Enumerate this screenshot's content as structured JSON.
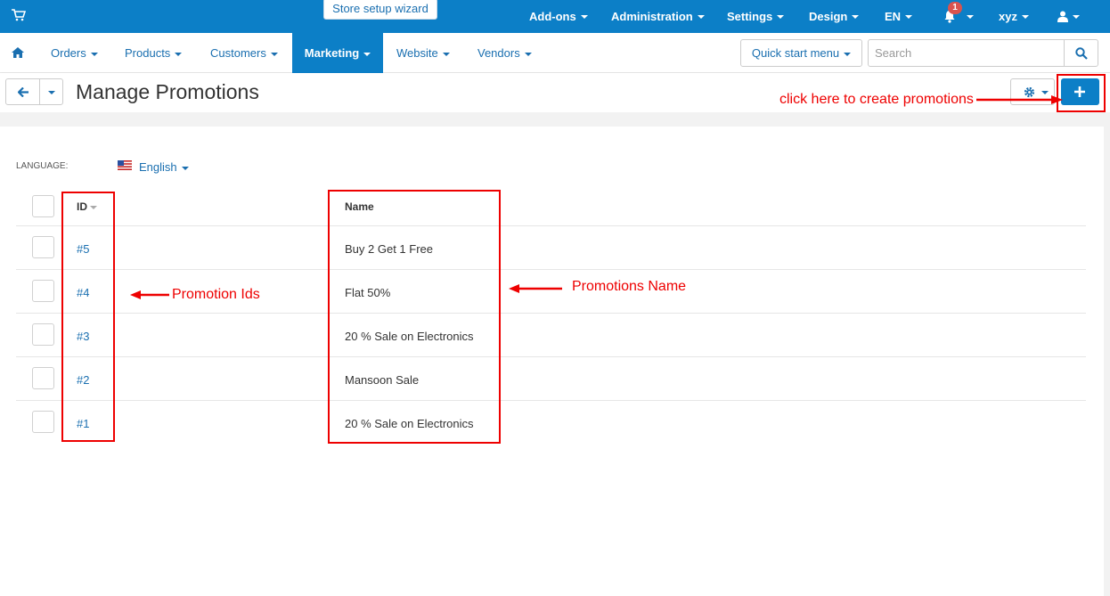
{
  "topbar": {
    "wizard_label": "Store setup wizard",
    "items": [
      "Add-ons",
      "Administration",
      "Settings",
      "Design",
      "EN",
      "xyz"
    ],
    "notification_count": "1"
  },
  "mainnav": {
    "items": [
      "Orders",
      "Products",
      "Customers",
      "Marketing",
      "Website",
      "Vendors"
    ],
    "active": "Marketing",
    "quick_start": "Quick start menu",
    "search_placeholder": "Search"
  },
  "page": {
    "title": "Manage Promotions"
  },
  "language": {
    "label": "LANGUAGE:",
    "value": "English"
  },
  "table": {
    "headers": {
      "id": "ID",
      "name": "Name"
    },
    "rows": [
      {
        "id": "#5",
        "name": "Buy 2 Get 1 Free"
      },
      {
        "id": "#4",
        "name": "Flat 50%"
      },
      {
        "id": "#3",
        "name": "20 % Sale on Electronics"
      },
      {
        "id": "#2",
        "name": "Mansoon Sale"
      },
      {
        "id": "#1",
        "name": "20 % Sale on Electronics"
      }
    ]
  },
  "annotations": {
    "create": "click here to create promotions",
    "ids": "Promotion Ids",
    "names": "Promotions Name"
  },
  "colors": {
    "primary": "#0c7fc7",
    "link": "#1a6fb0",
    "annotation": "#ee0000"
  }
}
